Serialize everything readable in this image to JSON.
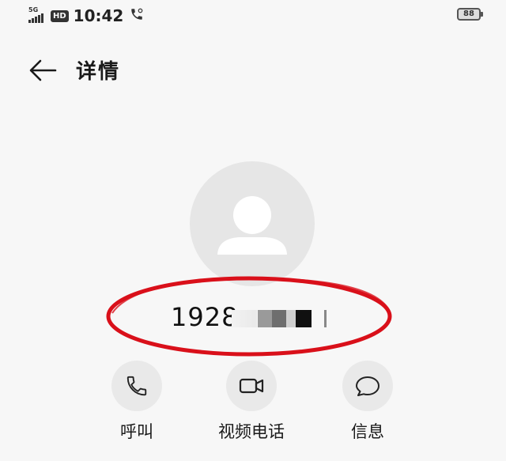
{
  "status_bar": {
    "network_tag": "5G",
    "hd_label": "HD",
    "time": "10:42",
    "battery_level": "88"
  },
  "header": {
    "title": "详情"
  },
  "contact": {
    "number_visible": "1928",
    "number_masked": true,
    "highlight_color": "#d9101a"
  },
  "actions": [
    {
      "label": "呼叫",
      "icon": "phone-icon"
    },
    {
      "label": "视频电话",
      "icon": "video-camera-icon"
    },
    {
      "label": "信息",
      "icon": "message-bubble-icon"
    }
  ]
}
